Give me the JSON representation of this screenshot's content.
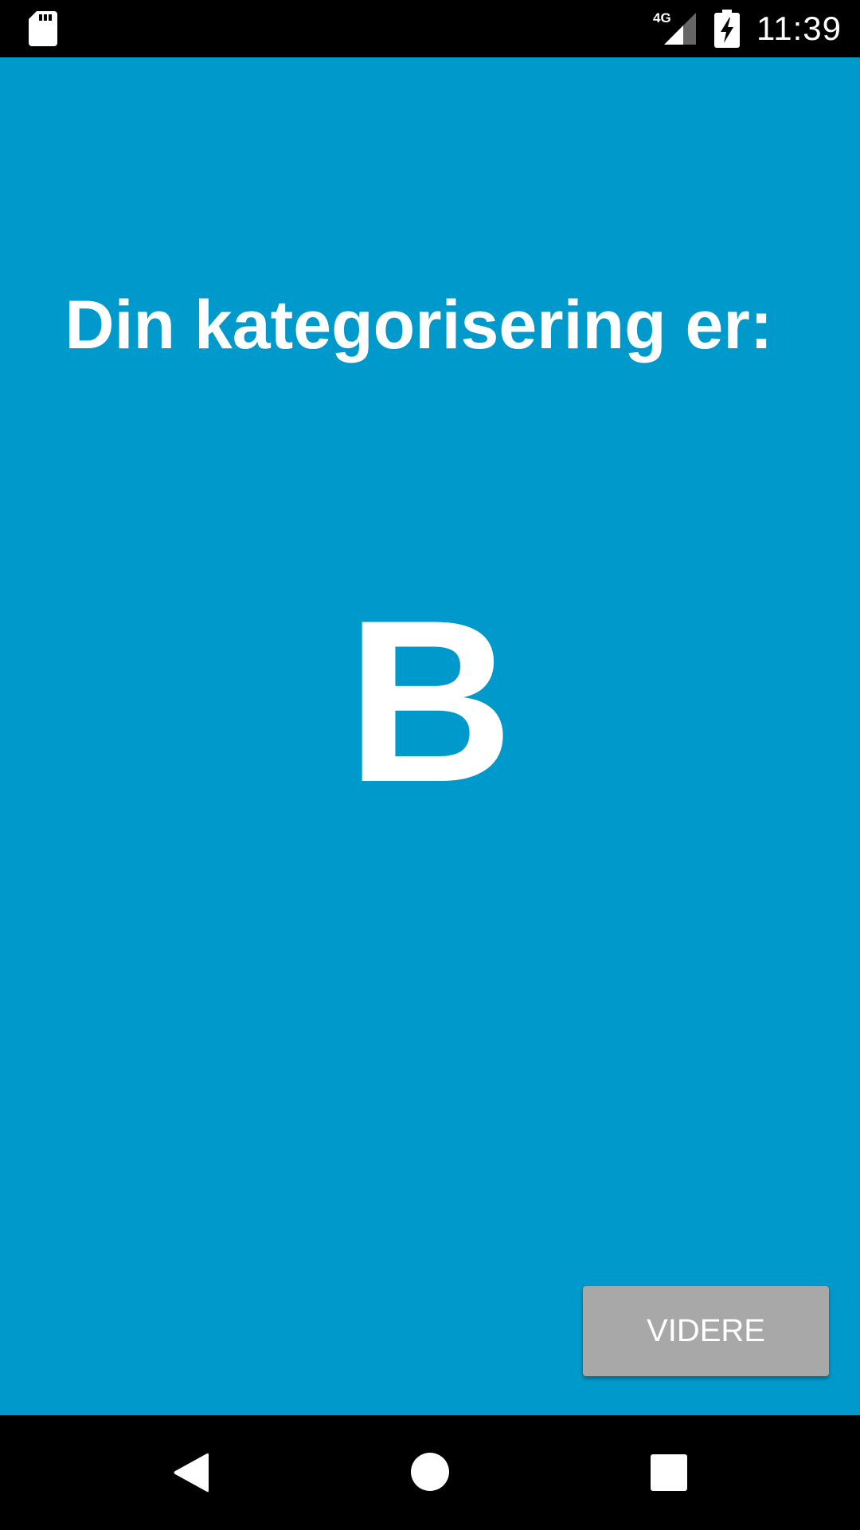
{
  "status_bar": {
    "time": "11:39",
    "network_type": "4G",
    "icons": [
      "sd-card-icon",
      "signal-icon",
      "battery-charging-icon"
    ]
  },
  "main": {
    "title": "Din kategorisering er:",
    "category": "B",
    "next_button_label": "VIDERE"
  },
  "navigation_bar": {
    "icons": [
      "back-icon",
      "home-icon",
      "recents-icon"
    ]
  },
  "colors": {
    "background": "#0099cc",
    "button": "#a8a8a8",
    "text": "#ffffff"
  }
}
